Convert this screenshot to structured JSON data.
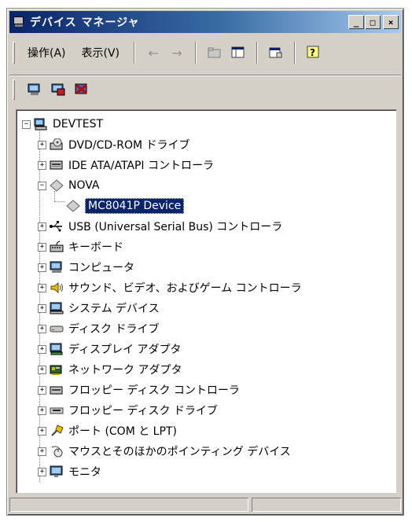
{
  "window": {
    "title": "デバイス マネージャ"
  },
  "titlebar_buttons": {
    "minimize": "_",
    "maximize": "□",
    "close": "×"
  },
  "menu": {
    "action": "操作(A)",
    "view": "表示(V)"
  },
  "tree": {
    "root": "DEVTEST",
    "items": [
      {
        "label": "DVD/CD-ROM ドライブ",
        "icon": "cdrom-icon",
        "expander": "+"
      },
      {
        "label": "IDE ATA/ATAPI コントローラ",
        "icon": "ide-controller-icon",
        "expander": "+"
      },
      {
        "label": "NOVA",
        "icon": "diamond-device-icon",
        "expander": "−"
      },
      {
        "label": "MC8041P Device",
        "icon": "diamond-device-icon",
        "expander": ""
      },
      {
        "label": "USB (Universal Serial Bus) コントローラ",
        "icon": "usb-icon",
        "expander": "+"
      },
      {
        "label": "キーボード",
        "icon": "keyboard-icon",
        "expander": "+"
      },
      {
        "label": "コンピュータ",
        "icon": "computer-icon",
        "expander": "+"
      },
      {
        "label": "サウンド、ビデオ、およびゲーム コントローラ",
        "icon": "sound-icon",
        "expander": "+"
      },
      {
        "label": "システム デバイス",
        "icon": "system-device-icon",
        "expander": "+"
      },
      {
        "label": "ディスク ドライブ",
        "icon": "disk-drive-icon",
        "expander": "+"
      },
      {
        "label": "ディスプレイ アダプタ",
        "icon": "display-adapter-icon",
        "expander": "+"
      },
      {
        "label": "ネットワーク アダプタ",
        "icon": "network-adapter-icon",
        "expander": "+"
      },
      {
        "label": "フロッピー ディスク コントローラ",
        "icon": "floppy-controller-icon",
        "expander": "+"
      },
      {
        "label": "フロッピー ディスク ドライブ",
        "icon": "floppy-drive-icon",
        "expander": "+"
      },
      {
        "label": "ポート (COM と LPT)",
        "icon": "port-icon",
        "expander": "+"
      },
      {
        "label": "マウスとそのほかのポインティング デバイス",
        "icon": "mouse-icon",
        "expander": "+"
      },
      {
        "label": "モニタ",
        "icon": "monitor-icon",
        "expander": "+"
      }
    ]
  },
  "colors": {
    "title_start": "#0a246a",
    "title_end": "#a6caf0",
    "selection": "#0a246a",
    "face": "#d4d0c8"
  }
}
